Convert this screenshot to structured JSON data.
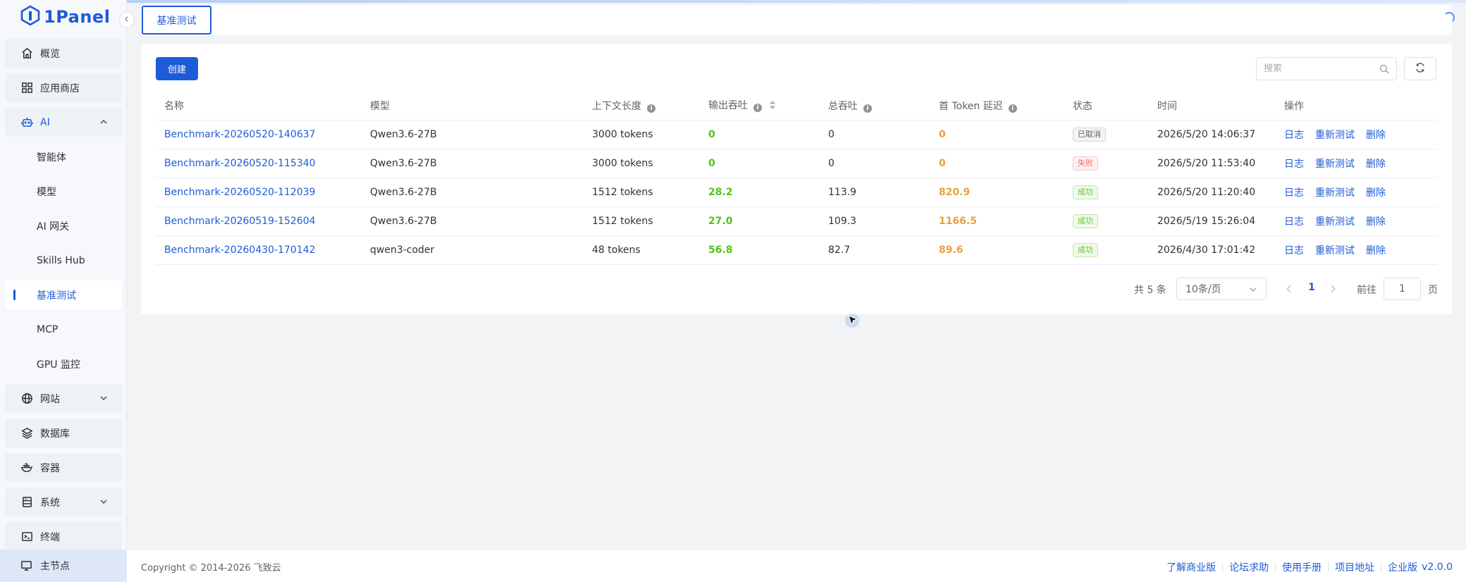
{
  "app": {
    "logo_text": "1Panel",
    "brand_color": "#1d5bd8"
  },
  "sidebar": {
    "items": [
      {
        "label": "概览",
        "icon": "home-icon"
      },
      {
        "label": "应用商店",
        "icon": "grid-icon"
      },
      {
        "label": "AI",
        "icon": "robot-icon",
        "expanded": true
      },
      {
        "label": "网站",
        "icon": "globe-icon"
      },
      {
        "label": "数据库",
        "icon": "layers-icon"
      },
      {
        "label": "容器",
        "icon": "docker-icon"
      },
      {
        "label": "系统",
        "icon": "server-icon"
      },
      {
        "label": "终端",
        "icon": "terminal-icon"
      }
    ],
    "ai_sub": [
      "智能体",
      "模型",
      "AI 网关",
      "Skills Hub",
      "基准测试",
      "MCP",
      "GPU 监控"
    ],
    "active_sub": "基准测试",
    "bottom": {
      "label": "主节点",
      "icon": "monitor-icon"
    }
  },
  "tabs": [
    {
      "label": "基准测试",
      "active": true
    }
  ],
  "toolbar": {
    "create_label": "创建",
    "search_placeholder": "搜索"
  },
  "table": {
    "columns": [
      "名称",
      "模型",
      "上下文长度",
      "输出吞吐",
      "总吞吐",
      "首 Token 延迟",
      "状态",
      "时间",
      "操作"
    ],
    "rows": [
      {
        "name": "Benchmark-20260520-140637",
        "model": "Qwen3.6-27B",
        "context": "3000 tokens",
        "out": "0",
        "total": "0",
        "ttft": "0",
        "status": "已取消",
        "status_type": "cancel",
        "time": "2026/5/20 14:06:37"
      },
      {
        "name": "Benchmark-20260520-115340",
        "model": "Qwen3.6-27B",
        "context": "3000 tokens",
        "out": "0",
        "total": "0",
        "ttft": "0",
        "status": "失败",
        "status_type": "fail",
        "time": "2026/5/20 11:53:40"
      },
      {
        "name": "Benchmark-20260520-112039",
        "model": "Qwen3.6-27B",
        "context": "1512 tokens",
        "out": "28.2",
        "total": "113.9",
        "ttft": "820.9",
        "status": "成功",
        "status_type": "ok",
        "time": "2026/5/20 11:20:40"
      },
      {
        "name": "Benchmark-20260519-152604",
        "model": "Qwen3.6-27B",
        "context": "1512 tokens",
        "out": "27.0",
        "total": "109.3",
        "ttft": "1166.5",
        "status": "成功",
        "status_type": "ok",
        "time": "2026/5/19 15:26:04"
      },
      {
        "name": "Benchmark-20260430-170142",
        "model": "qwen3-coder",
        "context": "48 tokens",
        "out": "56.8",
        "total": "82.7",
        "ttft": "89.6",
        "status": "成功",
        "status_type": "ok",
        "time": "2026/4/30 17:01:42"
      }
    ],
    "actions": [
      "日志",
      "重新测试",
      "删除"
    ]
  },
  "pagination": {
    "total_text": "共 5 条",
    "page_size": "10条/页",
    "current_page": "1",
    "goto_label": "前往",
    "goto_value": "1",
    "page_unit": "页"
  },
  "footer": {
    "copyright": "Copyright © 2014-2026 飞致云",
    "links": [
      "了解商业版",
      "论坛求助",
      "使用手册",
      "项目地址",
      "企业版"
    ],
    "version": "v2.0.0"
  }
}
